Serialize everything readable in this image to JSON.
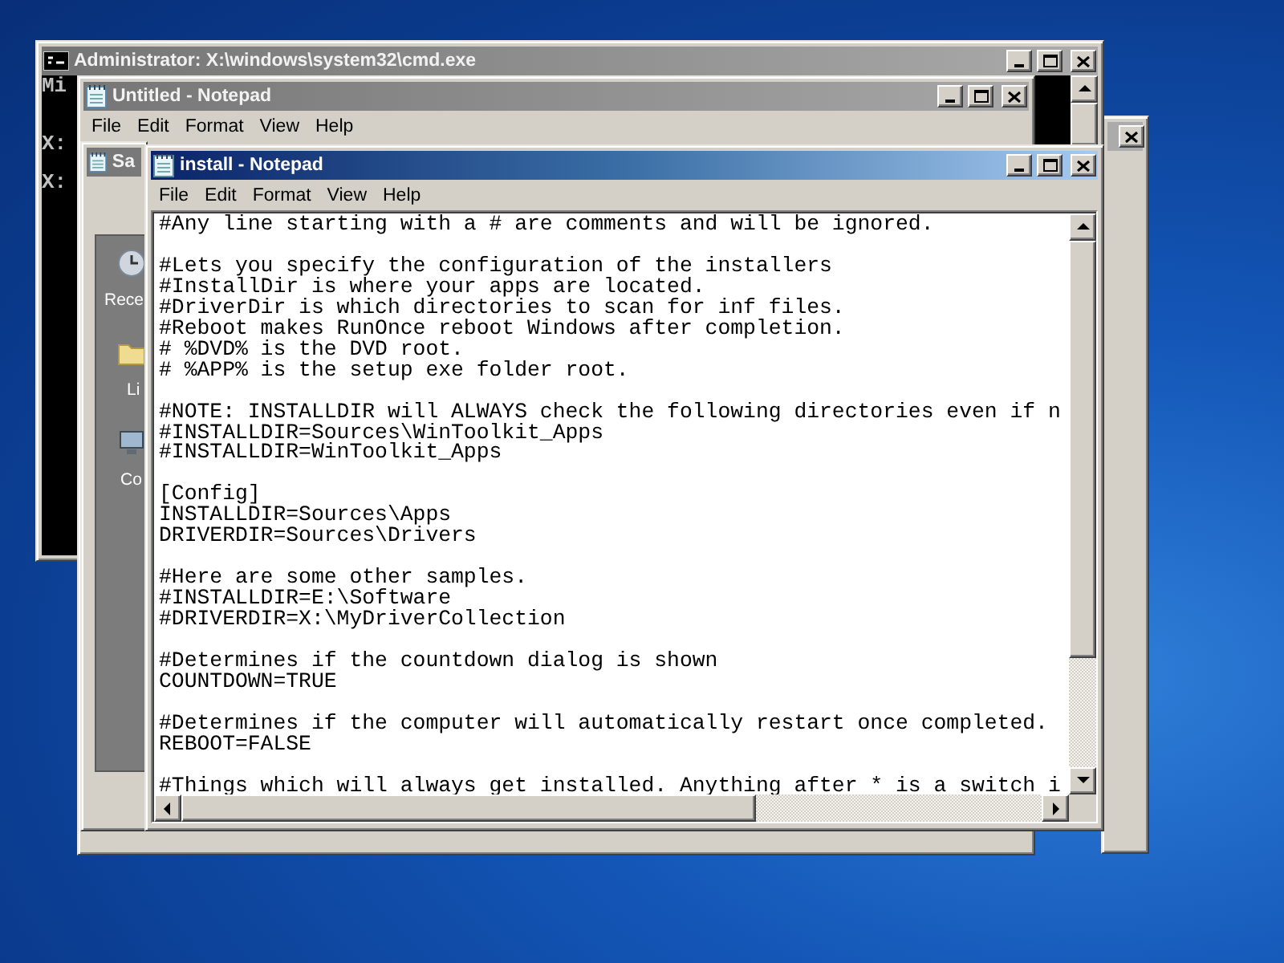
{
  "back_window": {
    "active": false
  },
  "console_window": {
    "title": "Administrator: X:\\windows\\system32\\cmd.exe",
    "active": false,
    "lines": [
      "Mi",
      "X:",
      "X:"
    ]
  },
  "untitled_notepad": {
    "title": "Untitled - Notepad",
    "active": false,
    "menu": [
      "File",
      "Edit",
      "Format",
      "View",
      "Help"
    ]
  },
  "save_dialog": {
    "title": "Sa",
    "active": false,
    "places": [
      {
        "label": "Rece",
        "kind": "recent"
      },
      {
        "label": "Li",
        "kind": "libraries"
      },
      {
        "label": "Co",
        "kind": "computer"
      }
    ]
  },
  "install_notepad": {
    "title": "install - Notepad",
    "active": true,
    "menu": [
      "File",
      "Edit",
      "Format",
      "View",
      "Help"
    ],
    "paragraphs": [
      [
        "#Any line starting with a # are comments and will be ignored."
      ],
      [
        "#Lets you specify the configuration of the installers",
        "#InstallDir is where your apps are located.",
        "#DriverDir is which directories to scan for inf files.",
        "#Reboot makes RunOnce reboot Windows after completion.",
        "# %DVD% is the DVD root.",
        "# %APP% is the setup exe folder root."
      ],
      [
        "#NOTE: INSTALLDIR will ALWAYS check the following directories even if n",
        "#INSTALLDIR=Sources\\WinToolkit_Apps",
        "#INSTALLDIR=WinToolkit_Apps"
      ],
      [
        "[Config]",
        "INSTALLDIR=Sources\\Apps",
        "DRIVERDIR=Sources\\Drivers"
      ],
      [
        "#Here are some other samples.",
        "#INSTALLDIR=E:\\Software",
        "#DRIVERDIR=X:\\MyDriverCollection"
      ],
      [
        "#Determines if the countdown dialog is shown",
        "COUNTDOWN=TRUE"
      ],
      [
        "#Determines if the computer will automatically restart once completed.",
        "REBOOT=FALSE"
      ],
      [
        "#Things which will always get installed. Anything after * is a switch i"
      ]
    ]
  }
}
